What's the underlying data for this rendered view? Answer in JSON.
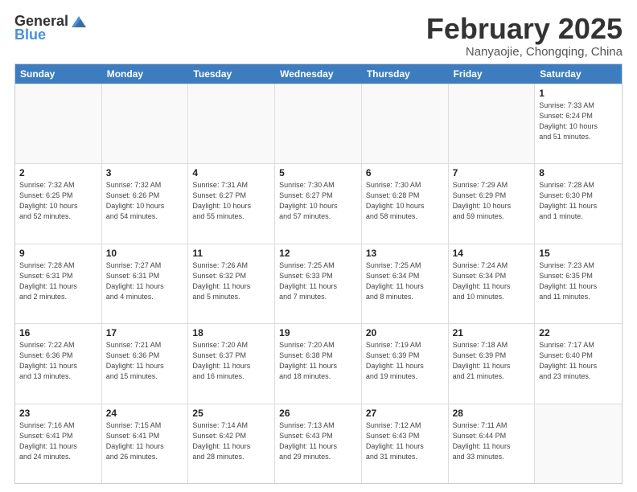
{
  "logo": {
    "text_general": "General",
    "text_blue": "Blue"
  },
  "title": "February 2025",
  "subtitle": "Nanyaojie, Chongqing, China",
  "header_days": [
    "Sunday",
    "Monday",
    "Tuesday",
    "Wednesday",
    "Thursday",
    "Friday",
    "Saturday"
  ],
  "rows": [
    [
      {
        "day": "",
        "info": "",
        "empty": true
      },
      {
        "day": "",
        "info": "",
        "empty": true
      },
      {
        "day": "",
        "info": "",
        "empty": true
      },
      {
        "day": "",
        "info": "",
        "empty": true
      },
      {
        "day": "",
        "info": "",
        "empty": true
      },
      {
        "day": "",
        "info": "",
        "empty": true
      },
      {
        "day": "1",
        "info": "Sunrise: 7:33 AM\nSunset: 6:24 PM\nDaylight: 10 hours\nand 51 minutes."
      }
    ],
    [
      {
        "day": "2",
        "info": "Sunrise: 7:32 AM\nSunset: 6:25 PM\nDaylight: 10 hours\nand 52 minutes."
      },
      {
        "day": "3",
        "info": "Sunrise: 7:32 AM\nSunset: 6:26 PM\nDaylight: 10 hours\nand 54 minutes."
      },
      {
        "day": "4",
        "info": "Sunrise: 7:31 AM\nSunset: 6:27 PM\nDaylight: 10 hours\nand 55 minutes."
      },
      {
        "day": "5",
        "info": "Sunrise: 7:30 AM\nSunset: 6:27 PM\nDaylight: 10 hours\nand 57 minutes."
      },
      {
        "day": "6",
        "info": "Sunrise: 7:30 AM\nSunset: 6:28 PM\nDaylight: 10 hours\nand 58 minutes."
      },
      {
        "day": "7",
        "info": "Sunrise: 7:29 AM\nSunset: 6:29 PM\nDaylight: 10 hours\nand 59 minutes."
      },
      {
        "day": "8",
        "info": "Sunrise: 7:28 AM\nSunset: 6:30 PM\nDaylight: 11 hours\nand 1 minute."
      }
    ],
    [
      {
        "day": "9",
        "info": "Sunrise: 7:28 AM\nSunset: 6:31 PM\nDaylight: 11 hours\nand 2 minutes."
      },
      {
        "day": "10",
        "info": "Sunrise: 7:27 AM\nSunset: 6:31 PM\nDaylight: 11 hours\nand 4 minutes."
      },
      {
        "day": "11",
        "info": "Sunrise: 7:26 AM\nSunset: 6:32 PM\nDaylight: 11 hours\nand 5 minutes."
      },
      {
        "day": "12",
        "info": "Sunrise: 7:25 AM\nSunset: 6:33 PM\nDaylight: 11 hours\nand 7 minutes."
      },
      {
        "day": "13",
        "info": "Sunrise: 7:25 AM\nSunset: 6:34 PM\nDaylight: 11 hours\nand 8 minutes."
      },
      {
        "day": "14",
        "info": "Sunrise: 7:24 AM\nSunset: 6:34 PM\nDaylight: 11 hours\nand 10 minutes."
      },
      {
        "day": "15",
        "info": "Sunrise: 7:23 AM\nSunset: 6:35 PM\nDaylight: 11 hours\nand 11 minutes."
      }
    ],
    [
      {
        "day": "16",
        "info": "Sunrise: 7:22 AM\nSunset: 6:36 PM\nDaylight: 11 hours\nand 13 minutes."
      },
      {
        "day": "17",
        "info": "Sunrise: 7:21 AM\nSunset: 6:36 PM\nDaylight: 11 hours\nand 15 minutes."
      },
      {
        "day": "18",
        "info": "Sunrise: 7:20 AM\nSunset: 6:37 PM\nDaylight: 11 hours\nand 16 minutes."
      },
      {
        "day": "19",
        "info": "Sunrise: 7:20 AM\nSunset: 6:38 PM\nDaylight: 11 hours\nand 18 minutes."
      },
      {
        "day": "20",
        "info": "Sunrise: 7:19 AM\nSunset: 6:39 PM\nDaylight: 11 hours\nand 19 minutes."
      },
      {
        "day": "21",
        "info": "Sunrise: 7:18 AM\nSunset: 6:39 PM\nDaylight: 11 hours\nand 21 minutes."
      },
      {
        "day": "22",
        "info": "Sunrise: 7:17 AM\nSunset: 6:40 PM\nDaylight: 11 hours\nand 23 minutes."
      }
    ],
    [
      {
        "day": "23",
        "info": "Sunrise: 7:16 AM\nSunset: 6:41 PM\nDaylight: 11 hours\nand 24 minutes."
      },
      {
        "day": "24",
        "info": "Sunrise: 7:15 AM\nSunset: 6:41 PM\nDaylight: 11 hours\nand 26 minutes."
      },
      {
        "day": "25",
        "info": "Sunrise: 7:14 AM\nSunset: 6:42 PM\nDaylight: 11 hours\nand 28 minutes."
      },
      {
        "day": "26",
        "info": "Sunrise: 7:13 AM\nSunset: 6:43 PM\nDaylight: 11 hours\nand 29 minutes."
      },
      {
        "day": "27",
        "info": "Sunrise: 7:12 AM\nSunset: 6:43 PM\nDaylight: 11 hours\nand 31 minutes."
      },
      {
        "day": "28",
        "info": "Sunrise: 7:11 AM\nSunset: 6:44 PM\nDaylight: 11 hours\nand 33 minutes."
      },
      {
        "day": "",
        "info": "",
        "empty": true
      }
    ]
  ]
}
